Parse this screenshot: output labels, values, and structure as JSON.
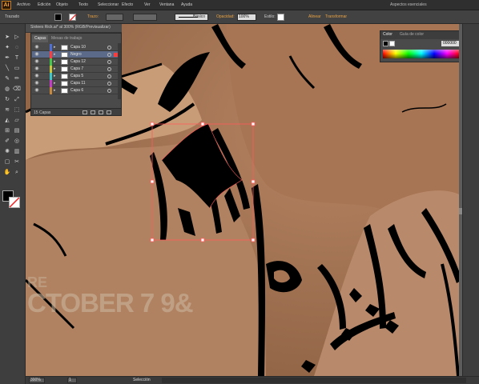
{
  "app": {
    "logo_text": "Ai",
    "menu": [
      "Archivo",
      "Edición",
      "Objeto",
      "Texto",
      "Seleccionar",
      "Efecto",
      "Ver",
      "Ventana",
      "Ayuda"
    ],
    "workspace": "Aspectos esenciales"
  },
  "control_bar": {
    "left_label": "Trazado",
    "stroke_label": "Trazo:",
    "basic_label": "Básico",
    "opacity_link": "Opacidad:",
    "opacity_value": "100%",
    "style_label": "Estilo:",
    "align_link": "Alinear",
    "transform_link": "Transformar"
  },
  "document": {
    "tab_title": "Sixtees Rick.ai* al 300% (RGB/Previsualizar)",
    "watermark_line1": "RE",
    "watermark_line2": "CTOBER 7 9&"
  },
  "layers_panel": {
    "tab_active": "Capas",
    "tab_inactive": "Mesas de trabajo",
    "layers": [
      {
        "name": "Capa 10",
        "color": "#4e6fd8"
      },
      {
        "name": "Negro",
        "color": "#ff3b3b",
        "selected": true
      },
      {
        "name": "Capa 12",
        "color": "#44c84a"
      },
      {
        "name": "Capa 7",
        "color": "#c8c83b"
      },
      {
        "name": "Capa 5",
        "color": "#3bc8c8"
      },
      {
        "name": "Capa 11",
        "color": "#c83bc8"
      },
      {
        "name": "Capa 6",
        "color": "#c8883b"
      }
    ],
    "footer_count": "15 Capas"
  },
  "color_panel": {
    "tab_active": "Color",
    "tab_inactive": "Guía de color",
    "hex": "000000"
  },
  "status": {
    "zoom": "300%",
    "page": "1",
    "selection_label": "Selección"
  },
  "colors": {
    "accent": "#f2a03b",
    "selection": "#ff5a5a",
    "skin": "#a47656"
  },
  "icons": {
    "tools": [
      "selection-arrow-icon",
      "direct-selection-icon",
      "magic-wand-icon",
      "lasso-icon",
      "pen-icon",
      "type-icon",
      "line-icon",
      "rectangle-icon",
      "paintbrush-icon",
      "pencil-icon",
      "blob-brush-icon",
      "eraser-icon",
      "rotate-icon",
      "scale-icon",
      "width-icon",
      "free-transform-icon",
      "shape-builder-icon",
      "perspective-icon",
      "mesh-icon",
      "gradient-icon",
      "eyedropper-icon",
      "blend-icon",
      "symbol-sprayer-icon",
      "graph-icon",
      "artboard-icon",
      "slice-icon",
      "hand-icon",
      "zoom-icon"
    ]
  }
}
